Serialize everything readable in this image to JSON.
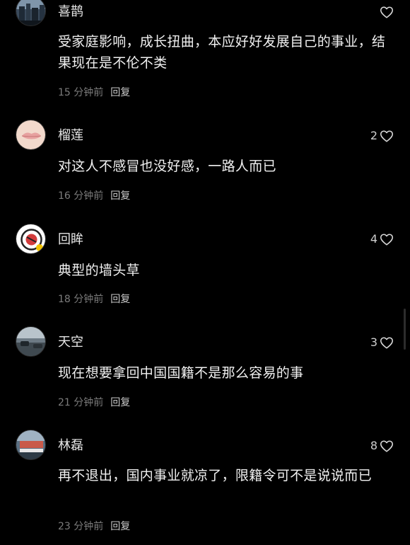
{
  "comments": [
    {
      "username": "喜鹊",
      "body": "受家庭影响，成长扭曲，本应好好发展自己的事业，结果现在是不伦不类",
      "time": "15 分钟前",
      "reply": "回复",
      "likes": "",
      "avatar_icon": "city-photo-avatar"
    },
    {
      "username": "榴莲",
      "body": "对这人不感冒也没好感，一路人而已",
      "time": "16 分钟前",
      "reply": "回复",
      "likes": "2",
      "avatar_icon": "lips-avatar"
    },
    {
      "username": "回眸",
      "body": "典型的墙头草",
      "time": "18 分钟前",
      "reply": "回复",
      "likes": "4",
      "avatar_icon": "cartoon-badge-avatar"
    },
    {
      "username": "天空",
      "body": "现在想要拿回中国国籍不是那么容易的事",
      "time": "21 分钟前",
      "reply": "回复",
      "likes": "3",
      "avatar_icon": "street-photo-avatar"
    },
    {
      "username": "林磊",
      "body": "再不退出，国内事业就凉了，限籍令可不是说说而已",
      "time": "23 分钟前",
      "reply": "回复",
      "likes": "8",
      "avatar_icon": "dock-photo-avatar"
    }
  ],
  "colors": {
    "background": "#000000",
    "text": "#f1f1f1",
    "meta": "#7c7c7c",
    "heart": "#d8d8d8"
  }
}
